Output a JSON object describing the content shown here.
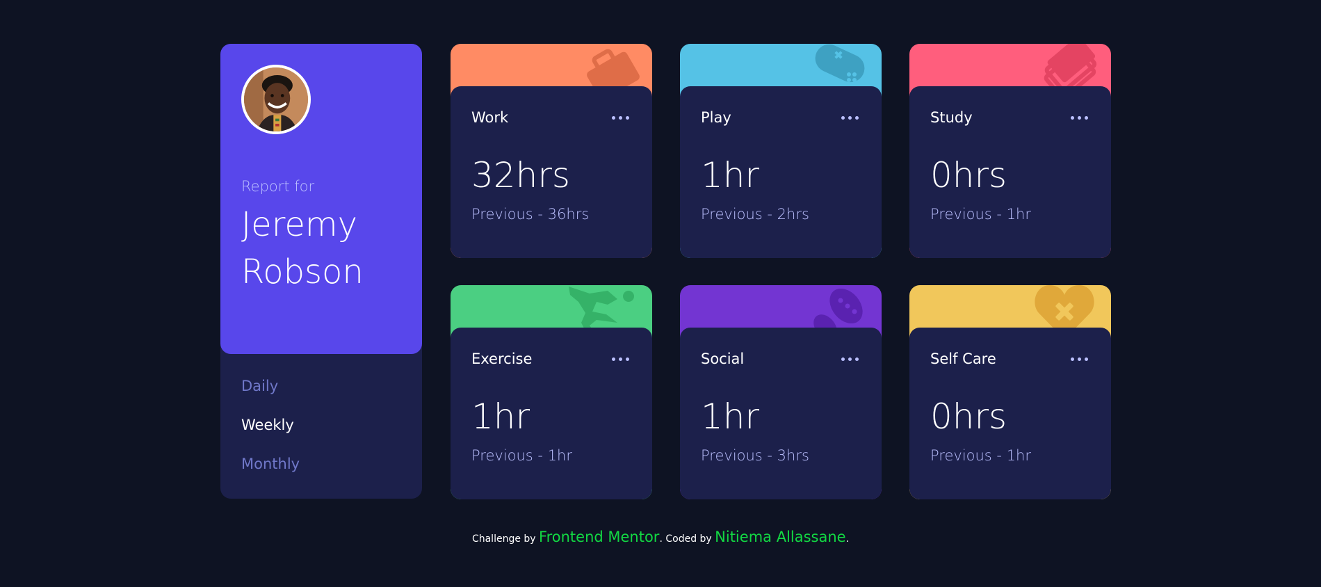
{
  "profile": {
    "report_for": "Report for",
    "first_name": "Jeremy",
    "last_name": "Robson"
  },
  "periods": [
    {
      "label": "Daily",
      "active": false
    },
    {
      "label": "Weekly",
      "active": true
    },
    {
      "label": "Monthly",
      "active": false
    }
  ],
  "cards": [
    {
      "title": "Work",
      "current": "32hrs",
      "previous": "Previous - 36hrs",
      "color": "#ff8b64",
      "icon": "briefcase-icon"
    },
    {
      "title": "Play",
      "current": "1hr",
      "previous": "Previous - 2hrs",
      "color": "#55c2e6",
      "icon": "gamepad-icon"
    },
    {
      "title": "Study",
      "current": "0hrs",
      "previous": "Previous - 1hr",
      "color": "#ff5e7d",
      "icon": "books-icon"
    },
    {
      "title": "Exercise",
      "current": "1hr",
      "previous": "Previous - 1hr",
      "color": "#4bcf82",
      "icon": "runner-icon"
    },
    {
      "title": "Social",
      "current": "1hr",
      "previous": "Previous - 3hrs",
      "color": "#7335d2",
      "icon": "chat-icon"
    },
    {
      "title": "Self Care",
      "current": "0hrs",
      "previous": "Previous - 1hr",
      "color": "#f1c75b",
      "icon": "heart-icon"
    }
  ],
  "footer": {
    "challenge_by": "Challenge by ",
    "frontend_mentor": "Frontend Mentor",
    "coded_by": ". Coded by ",
    "author": "Nitiema Allassane",
    "end": "."
  }
}
